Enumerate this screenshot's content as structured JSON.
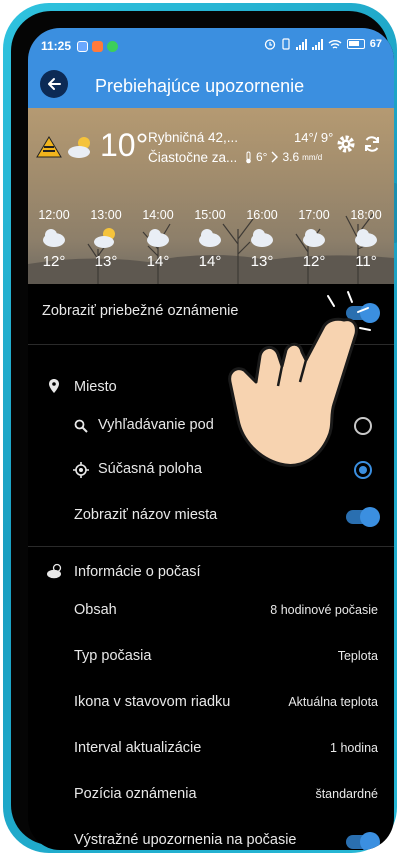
{
  "status_bar": {
    "time": "11:25",
    "battery": "67"
  },
  "app_bar": {
    "title": "Prebiehajúce upozornenie"
  },
  "weather": {
    "current_temp": "10°",
    "location": "Rybničná 42,...",
    "condition": "Čiastočne za...",
    "hi_lo": "14°/ 9°",
    "feels_like": "6°",
    "wind": "3.6",
    "wind_unit": "mm/d",
    "hours": [
      {
        "time": "12:00",
        "temp": "12°",
        "icon": "cloud-icon"
      },
      {
        "time": "13:00",
        "temp": "13°",
        "icon": "partly-sunny-icon"
      },
      {
        "time": "14:00",
        "temp": "14°",
        "icon": "cloud-icon"
      },
      {
        "time": "15:00",
        "temp": "14°",
        "icon": "cloud-icon"
      },
      {
        "time": "16:00",
        "temp": "13°",
        "icon": "cloud-icon"
      },
      {
        "time": "17:00",
        "temp": "12°",
        "icon": "cloud-icon"
      },
      {
        "time": "18:00",
        "temp": "11°",
        "icon": "cloud-icon"
      }
    ]
  },
  "settings": {
    "show_notification": {
      "label": "Zobraziť priebežné oznámenie",
      "enabled": true
    },
    "location_section": "Miesto",
    "search_location": {
      "label": "Vyhľadávanie pod",
      "selected": false
    },
    "current_location": {
      "label": "Súčasná poloha",
      "selected": true
    },
    "show_location_name": {
      "label": "Zobraziť názov miesta",
      "enabled": true
    },
    "weather_section": "Informácie o počasí",
    "items": [
      {
        "label": "Obsah",
        "value": "8 hodinové počasie"
      },
      {
        "label": "Typ počasia",
        "value": "Teplota"
      },
      {
        "label": "Ikona v stavovom riadku",
        "value": "Aktuálna teplota"
      },
      {
        "label": "Interval aktualizácie",
        "value": "1 hodina"
      },
      {
        "label": "Pozícia oznámenia",
        "value": "štandardné"
      }
    ],
    "weather_alerts": {
      "label": "Výstražné upozornenia na počasie",
      "enabled": true
    }
  },
  "colors": {
    "accent": "#3b8fe0",
    "phone_frame": "#1fb0d2",
    "background": "#000000"
  }
}
